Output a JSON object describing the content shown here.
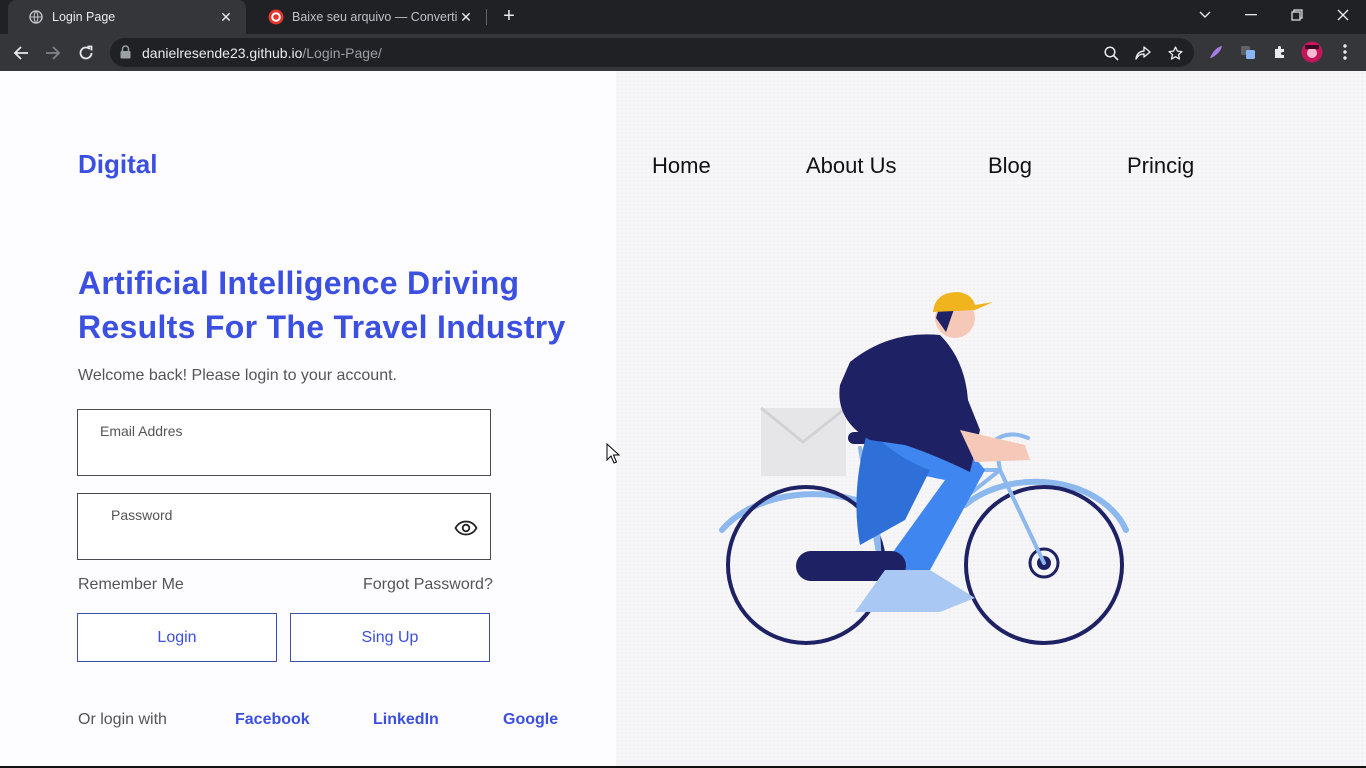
{
  "browser": {
    "tabs": [
      {
        "title": "Login Page",
        "active": true,
        "icon": "globe-icon"
      },
      {
        "title": "Baixe seu arquivo — Convertio",
        "active": false,
        "icon": "convertio-icon"
      }
    ],
    "url_host": "danielresende23.github.io",
    "url_path": "/Login-Page/"
  },
  "page": {
    "brand": "Digital",
    "nav": [
      "Home",
      "About Us",
      "Blog",
      "Princig"
    ],
    "headline": "Artificial Intelligence Driving Results For The Travel Industry",
    "welcome": "Welcome back! Please login to your account.",
    "email_label": "Email Addres",
    "password_label": "Password",
    "remember": "Remember Me",
    "forgot": "Forgot Password?",
    "login_button": "Login",
    "signup_button": "Sing Up",
    "or_login_with": "Or login with",
    "social": [
      "Facebook",
      "LinkedIn",
      "Google"
    ]
  },
  "colors": {
    "accent": "#3b4fe0",
    "chrome_dark": "#202124",
    "chrome_tab": "#35363a"
  }
}
